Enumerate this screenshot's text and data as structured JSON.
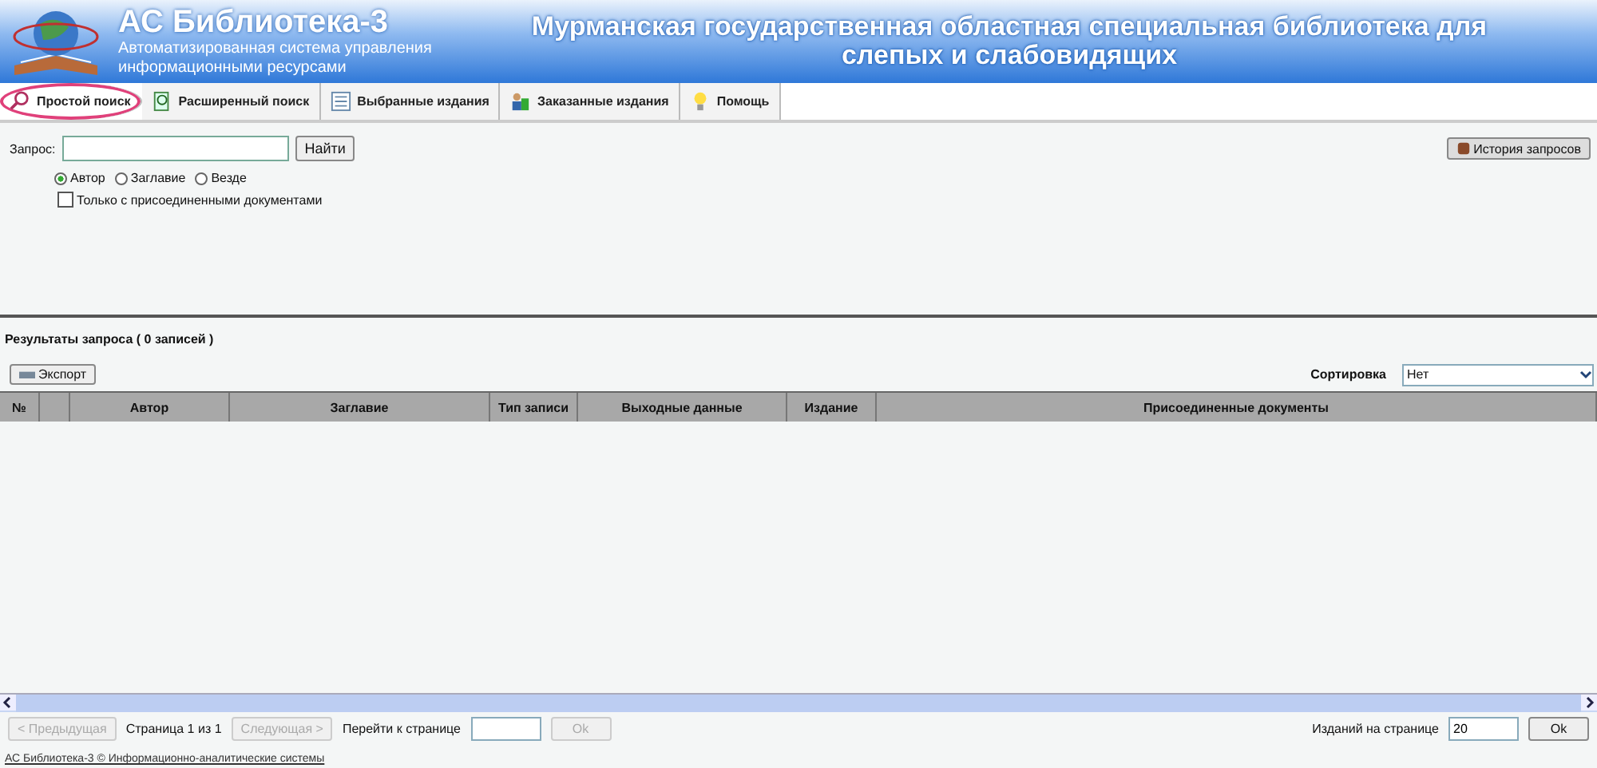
{
  "header": {
    "app_title": "АС Библиотека-3",
    "app_subtitle": "Автоматизированная система управления информационными ресурсами",
    "org_title": "Мурманская государственная областная специальная библиотека для слепых и слабовидящих"
  },
  "tabs": [
    {
      "label": "Простой поиск",
      "kind": "search",
      "selected": true,
      "highlighted": true
    },
    {
      "label": "Расширенный поиск",
      "kind": "advanced",
      "selected": false,
      "highlighted": false
    },
    {
      "label": "Выбранные издания",
      "kind": "list",
      "selected": false,
      "highlighted": false
    },
    {
      "label": "Заказанные издания",
      "kind": "people",
      "selected": false,
      "highlighted": false
    },
    {
      "label": "Помощь",
      "kind": "bulb",
      "selected": false,
      "highlighted": false
    }
  ],
  "search": {
    "label": "Запрос:",
    "button": "Найти",
    "history_button": "История запросов",
    "scopes": [
      {
        "label": "Автор",
        "selected": true
      },
      {
        "label": "Заглавие",
        "selected": false
      },
      {
        "label": "Везде",
        "selected": false
      }
    ],
    "attached_only": {
      "label": "Только с присоединенными документами",
      "checked": false
    }
  },
  "results": {
    "title": "Результаты запроса ( 0 записей )",
    "export_button": "Экспорт",
    "sort_label": "Сортировка",
    "sort_value": "Нет",
    "columns": [
      "№",
      "",
      "Автор",
      "Заглавие",
      "Тип записи",
      "Выходные данные",
      "Издание",
      "Присоединенные документы"
    ]
  },
  "pager": {
    "prev": {
      "label": "< Предыдущая",
      "disabled": true
    },
    "page_info": "Страница 1 из 1",
    "next": {
      "label": "Следующая >",
      "disabled": true
    },
    "goto_label": "Перейти к странице",
    "goto_ok": {
      "label": "Ok",
      "disabled": true
    },
    "per_page_label": "Изданий на странице",
    "per_page_value": "20",
    "per_page_ok": {
      "label": "Ok",
      "disabled": false
    }
  },
  "footer": "АС Библиотека-3 © Информационно-аналитические системы"
}
